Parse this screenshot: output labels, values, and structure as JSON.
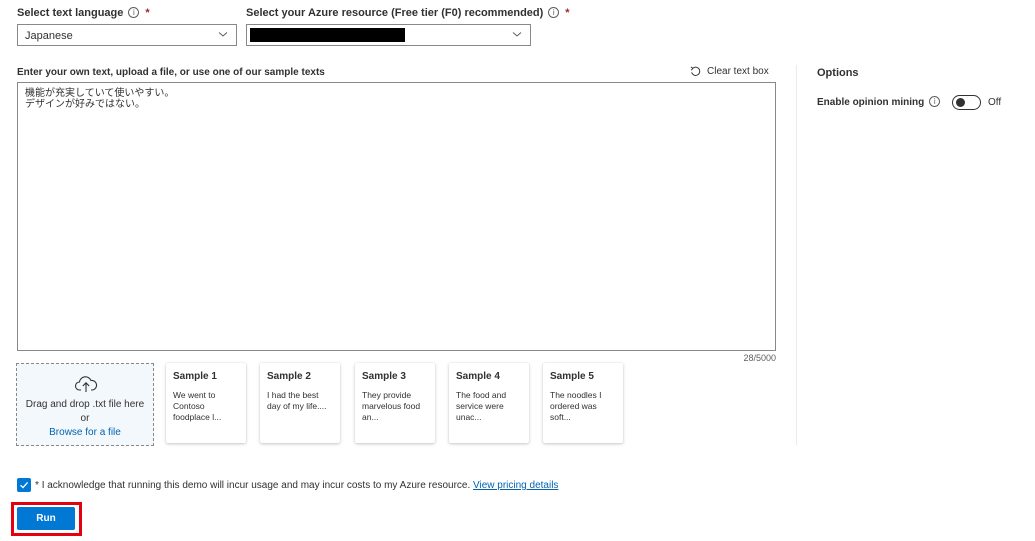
{
  "language": {
    "label": "Select text language",
    "required_mark": "*",
    "selected": "Japanese"
  },
  "resource": {
    "label": "Select your Azure resource (Free tier (F0) recommended)",
    "required_mark": "*",
    "selected": ""
  },
  "input": {
    "label": "Enter your own text, upload a file, or use one of our sample texts",
    "clear_label": "Clear text box",
    "lines": [
      "機能が充実していて使いやすい。",
      "デザインが好みではない。"
    ],
    "counter": "28/5000"
  },
  "upload": {
    "line1": "Drag and drop .txt file here",
    "line2": "or",
    "browse_label": "Browse for a file"
  },
  "samples": [
    {
      "title": "Sample 1",
      "preview": [
        "We went to",
        "Contoso",
        "foodplace l..."
      ]
    },
    {
      "title": "Sample 2",
      "preview": [
        "I had the best",
        "day of my life...."
      ]
    },
    {
      "title": "Sample 3",
      "preview": [
        "They provide",
        "marvelous food",
        "an..."
      ]
    },
    {
      "title": "Sample 4",
      "preview": [
        "The food and",
        "service were",
        "unac..."
      ]
    },
    {
      "title": "Sample 5",
      "preview": [
        "The noodles I",
        "ordered was",
        "soft..."
      ]
    }
  ],
  "options": {
    "title": "Options",
    "opinion_mining_label": "Enable opinion mining",
    "opinion_mining_state": "Off"
  },
  "acknowledge": {
    "required_mark": "*",
    "text": "I acknowledge that running this demo will incur usage and may incur costs to my Azure resource.",
    "link_label": "View pricing details",
    "checked": true
  },
  "run_label": "Run",
  "colors": {
    "accent": "#0078d4",
    "highlight": "#e3000f",
    "link": "#0063b1"
  }
}
